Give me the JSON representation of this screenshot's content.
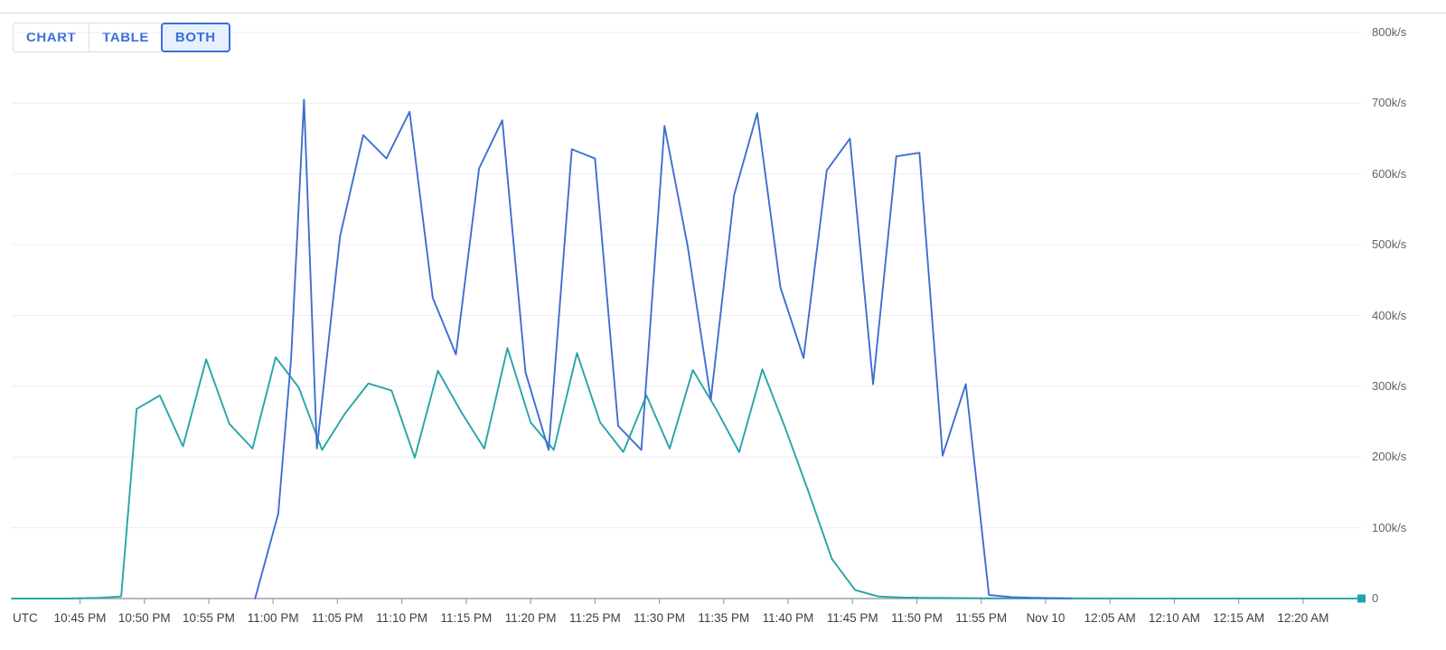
{
  "toolbar": {
    "view_modes": [
      {
        "label": "CHART",
        "selected": false
      },
      {
        "label": "TABLE",
        "selected": false
      },
      {
        "label": "BOTH",
        "selected": true
      }
    ]
  },
  "chart_data": {
    "type": "line",
    "title": "",
    "xlabel": "",
    "ylabel": "",
    "timezone_label": "UTC",
    "grid": true,
    "legend_position": "none",
    "ylim": [
      0,
      800000
    ],
    "y_tick_labels": [
      "0",
      "100k/s",
      "200k/s",
      "300k/s",
      "400k/s",
      "500k/s",
      "600k/s",
      "700k/s",
      "800k/s"
    ],
    "y_tick_values": [
      0,
      100000,
      200000,
      300000,
      400000,
      500000,
      600000,
      700000,
      800000
    ],
    "x_tick_labels": [
      "10:45 PM",
      "10:50 PM",
      "10:55 PM",
      "11:00 PM",
      "11:05 PM",
      "11:10 PM",
      "11:15 PM",
      "11:20 PM",
      "11:25 PM",
      "11:30 PM",
      "11:35 PM",
      "11:40 PM",
      "11:45 PM",
      "11:50 PM",
      "11:55 PM",
      "Nov 10",
      "12:05 AM",
      "12:10 AM",
      "12:15 AM",
      "12:20 AM"
    ],
    "x_tick_minutes": [
      0,
      5,
      10,
      15,
      20,
      25,
      30,
      35,
      40,
      45,
      50,
      55,
      60,
      65,
      70,
      75,
      80,
      85,
      90,
      95
    ],
    "x_range_minutes": [
      -5.3,
      99.5
    ],
    "endpoint_marker": {
      "color": "#21a0b5",
      "value": 0
    },
    "series": [
      {
        "name": "series-teal",
        "color": "#26a5a8",
        "x_minutes": [
          -5.3,
          -1.0,
          1.5,
          2.4,
          3.2,
          4.4,
          6.2,
          8.0,
          9.8,
          11.6,
          13.4,
          15.2,
          17.0,
          18.8,
          20.6,
          22.4,
          24.2,
          26.0,
          27.8,
          29.6,
          31.4,
          33.2,
          35.0,
          36.8,
          38.6,
          40.4,
          42.2,
          44.0,
          45.8,
          47.6,
          49.4,
          51.2,
          53.0,
          54.8,
          56.6,
          58.4,
          60.2,
          62.0,
          63.8,
          65.6,
          67.4,
          69.2,
          71.0,
          74.0,
          77.0,
          99.5
        ],
        "values": [
          0,
          0,
          1000,
          2000,
          3000,
          268000,
          287000,
          215000,
          338000,
          247000,
          212000,
          341000,
          298000,
          210000,
          262000,
          304000,
          294000,
          199000,
          322000,
          264000,
          212000,
          354000,
          249000,
          210000,
          347000,
          249000,
          207000,
          287000,
          212000,
          323000,
          268000,
          207000,
          324000,
          240000,
          150000,
          56000,
          12000,
          3000,
          1500,
          1000,
          800,
          500,
          300,
          200,
          150,
          100
        ]
      },
      {
        "name": "series-blue",
        "color": "#3d6fd0",
        "x_minutes": [
          13.6,
          15.4,
          16.4,
          17.4,
          18.4,
          20.2,
          22.0,
          23.8,
          25.6,
          27.4,
          29.2,
          31.0,
          32.8,
          34.6,
          36.4,
          38.2,
          40.0,
          41.8,
          43.6,
          45.4,
          47.2,
          49.0,
          50.8,
          52.6,
          54.4,
          56.2,
          58.0,
          59.8,
          61.6,
          63.4,
          65.2,
          67.0,
          68.8,
          70.6,
          72.4,
          74.2,
          76.0,
          77.0
        ],
        "values": [
          0,
          120000,
          340000,
          705000,
          212000,
          512000,
          655000,
          622000,
          688000,
          425000,
          345000,
          608000,
          676000,
          320000,
          210000,
          635000,
          622000,
          244000,
          210000,
          668000,
          498000,
          281000,
          570000,
          686000,
          440000,
          340000,
          605000,
          650000,
          303000,
          625000,
          630000,
          202000,
          303000,
          5000,
          2000,
          1000,
          500,
          200
        ]
      }
    ]
  }
}
